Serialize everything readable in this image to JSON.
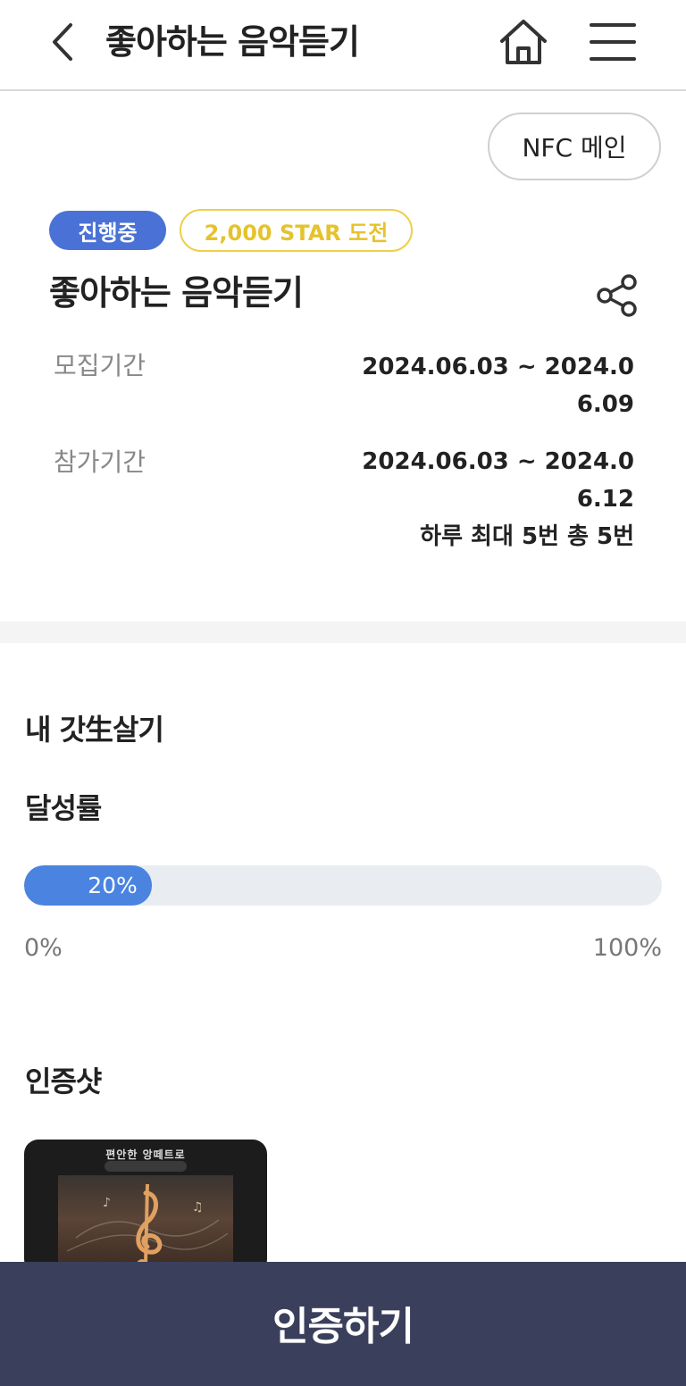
{
  "header": {
    "title": "좋아하는 음악듣기",
    "back_icon": "chevron-left-icon",
    "home_icon": "home-icon",
    "menu_icon": "hamburger-menu-icon"
  },
  "nfc_button": {
    "label": "NFC 메인"
  },
  "badges": {
    "status": "진행중",
    "star": "2,000 STAR 도전",
    "status_color": "#4a72d6",
    "star_color": "#e6c22c"
  },
  "challenge": {
    "title": "좋아하는 음악듣기",
    "share_icon": "share-icon"
  },
  "info": {
    "recruit_label": "모집기간",
    "recruit_value": "2024.06.03 ~ 2024.06.09",
    "participate_label": "참가기간",
    "participate_value": "2024.06.03 ~ 2024.06.12",
    "participate_limit": "하루 최대 5번 총 5번"
  },
  "progress_section": {
    "title": "내 갓生살기",
    "rate_label": "달성률",
    "percent": 20,
    "percent_label": "20%",
    "min_label": "0%",
    "max_label": "100%",
    "fill_color": "#4a84e0"
  },
  "photos_section": {
    "title": "인증샷",
    "photos": [
      {
        "caption": "편안한 앙떼트로"
      }
    ]
  },
  "cta": {
    "label": "인증하기",
    "color": "#3a3f5c"
  }
}
